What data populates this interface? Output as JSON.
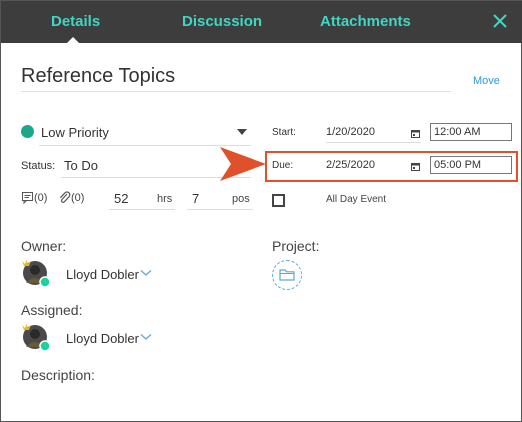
{
  "tabs": [
    {
      "label": "Details",
      "active": true
    },
    {
      "label": "Discussion",
      "active": false
    },
    {
      "label": "Attachments",
      "active": false
    }
  ],
  "task": {
    "title": "Reference Topics",
    "move_label": "Move",
    "priority": {
      "label": "Low Priority",
      "color": "#1aa88a"
    },
    "status": {
      "label": "Status:",
      "value": "To Do"
    },
    "discussion_count": "(0)",
    "attachment_count": "(0)",
    "hours": "52",
    "hours_unit": "hrs",
    "position": "7",
    "position_unit": "pos"
  },
  "dates": {
    "start": {
      "label": "Start:",
      "date": "1/20/2020",
      "time": "12:00 AM"
    },
    "due": {
      "label": "Due:",
      "date": "2/25/2020",
      "time": "05:00 PM"
    },
    "all_day_label": "All Day Event",
    "all_day_checked": false
  },
  "people": {
    "owner_label": "Owner:",
    "owner_name": "Lloyd Dobler",
    "assigned_label": "Assigned:",
    "assigned_name": "Lloyd Dobler",
    "project_label": "Project:",
    "description_label": "Description:"
  },
  "colors": {
    "header_bg": "#3d3d3d",
    "tab_accent": "#3fd6c2",
    "highlight": "#e0502a",
    "link": "#2a9bd8"
  }
}
